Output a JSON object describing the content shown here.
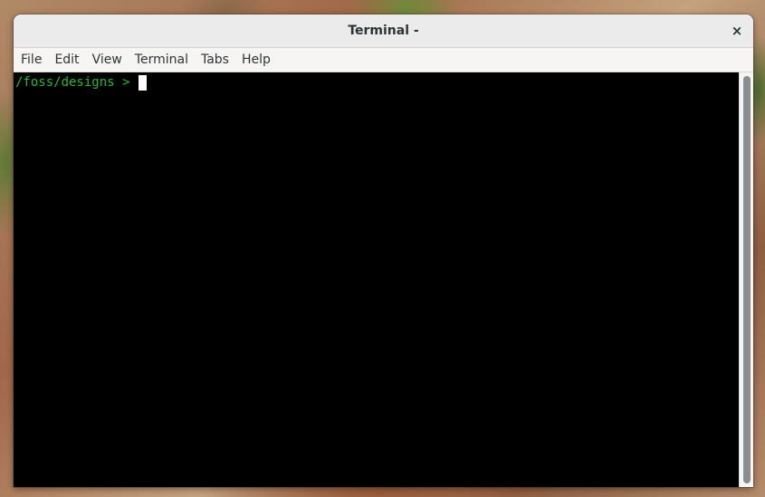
{
  "window": {
    "title": "Terminal -",
    "close_label": "×"
  },
  "menubar": {
    "items": [
      "File",
      "Edit",
      "View",
      "Terminal",
      "Tabs",
      "Help"
    ]
  },
  "terminal": {
    "prompt": "/foss/designs >",
    "input": ""
  },
  "colors": {
    "terminal_bg": "#000000",
    "prompt_fg": "#2cb72c",
    "cursor": "#ffffff"
  }
}
